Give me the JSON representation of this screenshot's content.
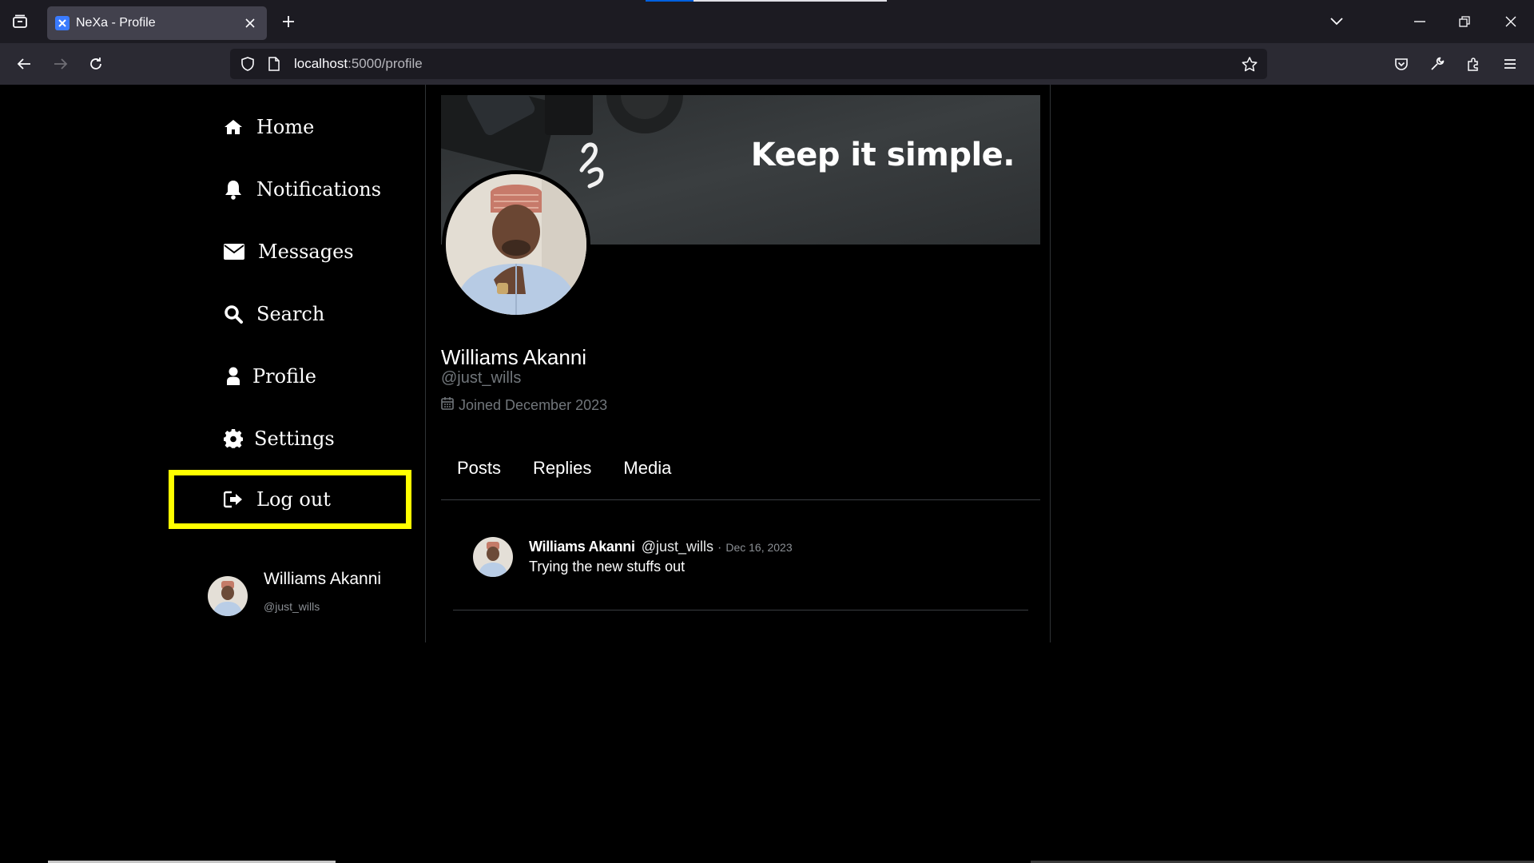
{
  "browser": {
    "tab_title": "NeXa - Profile",
    "url_host": "localhost",
    "url_path": ":5000/profile"
  },
  "sidebar": {
    "items": [
      {
        "label": "Home",
        "icon": "home-icon"
      },
      {
        "label": "Notifications",
        "icon": "bell-icon"
      },
      {
        "label": "Messages",
        "icon": "envelope-icon"
      },
      {
        "label": "Search",
        "icon": "search-icon"
      },
      {
        "label": "Profile",
        "icon": "user-icon"
      },
      {
        "label": "Settings",
        "icon": "gear-icon"
      },
      {
        "label": "Log out",
        "icon": "sign-out-icon"
      }
    ],
    "user": {
      "name": "Williams Akanni",
      "handle": "@just_wills"
    }
  },
  "profile": {
    "banner_text": "Keep it simple.",
    "name": "Williams Akanni",
    "handle": "@just_wills",
    "joined": "Joined December 2023"
  },
  "tabs": [
    "Posts",
    "Replies",
    "Media"
  ],
  "posts": [
    {
      "name": "Williams Akanni",
      "handle": "@just_wills",
      "separator": "·",
      "date": "Dec 16, 2023",
      "text": "Trying the new stuffs out"
    }
  ],
  "colors": {
    "highlight": "#ffff00",
    "background": "#000000",
    "muted": "#71767b"
  }
}
